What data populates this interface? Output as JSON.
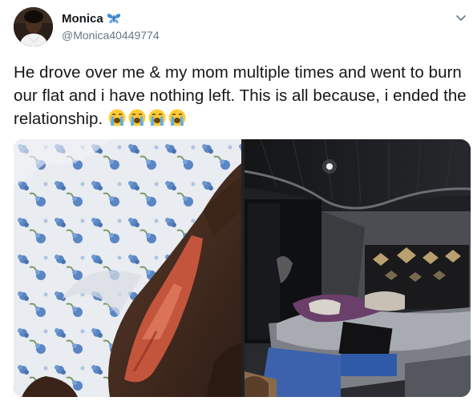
{
  "author": {
    "display_name": "Monica",
    "handle": "@Monica40449774",
    "avatar_icon": "profile-photo",
    "badge_icon": "butterfly-emoji",
    "badge_color": "#3a8fd6"
  },
  "menu": {
    "caret_icon": "chevron-down-icon"
  },
  "tweet": {
    "text": "He drove over me & my mom multiple times and went to burn our flat and i have nothing left. This is all because, i ended the relationship.",
    "emoji": [
      "loudly-crying-face",
      "loudly-crying-face",
      "loudly-crying-face",
      "loudly-crying-face"
    ]
  },
  "media": {
    "photos": [
      {
        "subject": "burned-arm-on-floral-bedsheet"
      },
      {
        "subject": "fire-damaged-bedroom"
      }
    ]
  },
  "colors": {
    "text": "#14171a",
    "secondary_text": "#657786",
    "background": "#ffffff"
  }
}
